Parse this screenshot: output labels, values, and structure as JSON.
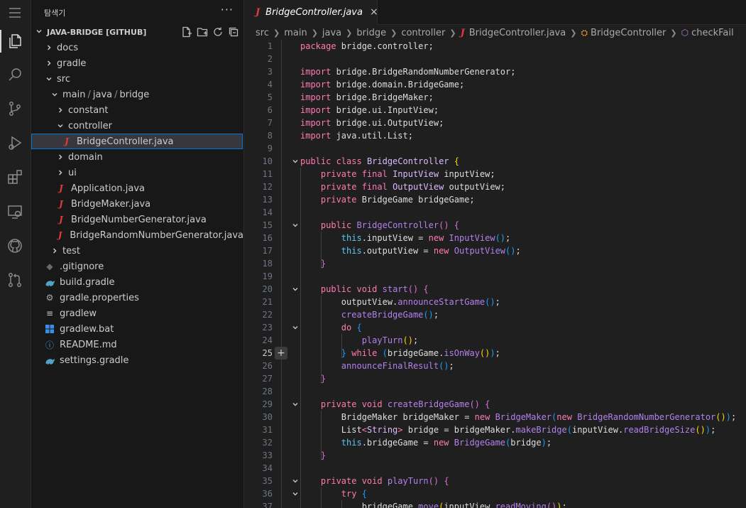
{
  "activity_bar": {
    "icons": [
      "menu-icon",
      "files-icon",
      "search-icon",
      "source-control-icon",
      "run-debug-icon",
      "extensions-icon",
      "remote-explorer-icon",
      "github-icon",
      "pull-requests-icon"
    ]
  },
  "sidebar": {
    "title": "탐색기",
    "more": "···",
    "section": "JAVA-BRIDGE [GITHUB]",
    "items": [
      {
        "label": "docs",
        "indent": 1,
        "kind": "folder",
        "open": false
      },
      {
        "label": "gradle",
        "indent": 1,
        "kind": "folder",
        "open": false
      },
      {
        "label": "src",
        "indent": 1,
        "kind": "folder",
        "open": true
      },
      {
        "label": "main/java/bridge",
        "indent": 2,
        "kind": "folder",
        "open": true,
        "compact": [
          "main",
          "java",
          "bridge"
        ]
      },
      {
        "label": "constant",
        "indent": 3,
        "kind": "folder",
        "open": false
      },
      {
        "label": "controller",
        "indent": 3,
        "kind": "folder",
        "open": true
      },
      {
        "label": "BridgeController.java",
        "indent": 4,
        "kind": "java",
        "selected": true
      },
      {
        "label": "domain",
        "indent": 3,
        "kind": "folder",
        "open": false
      },
      {
        "label": "ui",
        "indent": 3,
        "kind": "folder",
        "open": false
      },
      {
        "label": "Application.java",
        "indent": 3,
        "kind": "java"
      },
      {
        "label": "BridgeMaker.java",
        "indent": 3,
        "kind": "java"
      },
      {
        "label": "BridgeNumberGenerator.java",
        "indent": 3,
        "kind": "java"
      },
      {
        "label": "BridgeRandomNumberGenerator.java",
        "indent": 3,
        "kind": "java"
      },
      {
        "label": "test",
        "indent": 2,
        "kind": "folder",
        "open": false
      },
      {
        "label": ".gitignore",
        "indent": 1,
        "kind": "git"
      },
      {
        "label": "build.gradle",
        "indent": 1,
        "kind": "gradle"
      },
      {
        "label": "gradle.properties",
        "indent": 1,
        "kind": "gear"
      },
      {
        "label": "gradlew",
        "indent": 1,
        "kind": "lines"
      },
      {
        "label": "gradlew.bat",
        "indent": 1,
        "kind": "windows"
      },
      {
        "label": "README.md",
        "indent": 1,
        "kind": "info"
      },
      {
        "label": "settings.gradle",
        "indent": 1,
        "kind": "gradle"
      }
    ]
  },
  "tab": {
    "label": "BridgeController.java",
    "close": "×"
  },
  "breadcrumb": [
    "src",
    "main",
    "java",
    "bridge",
    "controller",
    "BridgeController.java",
    "BridgeController",
    "checkFail"
  ],
  "editor": {
    "cursor_line": 25,
    "fold_lines": [
      10,
      15,
      20,
      23,
      29,
      35,
      36
    ],
    "lines": [
      [
        [
          "kw",
          "package"
        ],
        [
          "pl",
          " bridge.controller;"
        ]
      ],
      [],
      [
        [
          "kw",
          "import"
        ],
        [
          "pl",
          " bridge.BridgeRandomNumberGenerator;"
        ]
      ],
      [
        [
          "kw",
          "import"
        ],
        [
          "pl",
          " bridge.domain.BridgeGame;"
        ]
      ],
      [
        [
          "kw",
          "import"
        ],
        [
          "pl",
          " bridge.BridgeMaker;"
        ]
      ],
      [
        [
          "kw",
          "import"
        ],
        [
          "pl",
          " bridge.ui.InputView;"
        ]
      ],
      [
        [
          "kw",
          "import"
        ],
        [
          "pl",
          " bridge.ui.OutputView;"
        ]
      ],
      [
        [
          "kw",
          "import"
        ],
        [
          "pl",
          " java.util.List;"
        ]
      ],
      [],
      [
        [
          "kw",
          "public class"
        ],
        [
          "pl",
          " "
        ],
        [
          "ty",
          "BridgeController"
        ],
        [
          "pl",
          " "
        ],
        [
          "pa1",
          "{"
        ]
      ],
      [
        [
          "pl",
          "    "
        ],
        [
          "kw",
          "private final"
        ],
        [
          "pl",
          " "
        ],
        [
          "ty",
          "InputView"
        ],
        [
          "pl",
          " inputView;"
        ]
      ],
      [
        [
          "pl",
          "    "
        ],
        [
          "kw",
          "private final"
        ],
        [
          "pl",
          " "
        ],
        [
          "ty",
          "OutputView"
        ],
        [
          "pl",
          " outputView;"
        ]
      ],
      [
        [
          "pl",
          "    "
        ],
        [
          "kw",
          "private"
        ],
        [
          "pl",
          " BridgeGame bridgeGame;"
        ]
      ],
      [],
      [
        [
          "pl",
          "    "
        ],
        [
          "kw",
          "public"
        ],
        [
          "pl",
          " "
        ],
        [
          "fn",
          "BridgeController"
        ],
        [
          "pa2",
          "()"
        ],
        [
          "pl",
          " "
        ],
        [
          "pa2",
          "{"
        ]
      ],
      [
        [
          "pl",
          "        "
        ],
        [
          "th",
          "this"
        ],
        [
          "pl",
          ".inputView = "
        ],
        [
          "kw",
          "new"
        ],
        [
          "pl",
          " "
        ],
        [
          "fn",
          "InputView"
        ],
        [
          "pa3",
          "()"
        ],
        [
          "pl",
          ";"
        ]
      ],
      [
        [
          "pl",
          "        "
        ],
        [
          "th",
          "this"
        ],
        [
          "pl",
          ".outputView = "
        ],
        [
          "kw",
          "new"
        ],
        [
          "pl",
          " "
        ],
        [
          "fn",
          "OutputView"
        ],
        [
          "pa3",
          "()"
        ],
        [
          "pl",
          ";"
        ]
      ],
      [
        [
          "pl",
          "    "
        ],
        [
          "pa2",
          "}"
        ]
      ],
      [],
      [
        [
          "pl",
          "    "
        ],
        [
          "kw",
          "public void"
        ],
        [
          "pl",
          " "
        ],
        [
          "fn",
          "start"
        ],
        [
          "pa2",
          "()"
        ],
        [
          "pl",
          " "
        ],
        [
          "pa2",
          "{"
        ]
      ],
      [
        [
          "pl",
          "        outputView."
        ],
        [
          "fn",
          "announceStartGame"
        ],
        [
          "pa3",
          "()"
        ],
        [
          "pl",
          ";"
        ]
      ],
      [
        [
          "pl",
          "        "
        ],
        [
          "fn",
          "createBridgeGame"
        ],
        [
          "pa3",
          "()"
        ],
        [
          "pl",
          ";"
        ]
      ],
      [
        [
          "pl",
          "        "
        ],
        [
          "kw",
          "do"
        ],
        [
          "pl",
          " "
        ],
        [
          "pa3",
          "{"
        ]
      ],
      [
        [
          "pl",
          "            "
        ],
        [
          "fn",
          "playTurn"
        ],
        [
          "pa1",
          "()"
        ],
        [
          "pl",
          ";"
        ]
      ],
      [
        [
          "pl",
          "        "
        ],
        [
          "pa3",
          "}"
        ],
        [
          "pl",
          " "
        ],
        [
          "kw",
          "while"
        ],
        [
          "pl",
          " "
        ],
        [
          "pa3",
          "("
        ],
        [
          "pl",
          "bridgeGame."
        ],
        [
          "fn",
          "isOnWay"
        ],
        [
          "pa1",
          "()"
        ],
        [
          "pa3",
          ")"
        ],
        [
          "pl",
          ";"
        ]
      ],
      [
        [
          "pl",
          "        "
        ],
        [
          "fn",
          "announceFinalResult"
        ],
        [
          "pa3",
          "()"
        ],
        [
          "pl",
          ";"
        ]
      ],
      [
        [
          "pl",
          "    "
        ],
        [
          "pa2",
          "}"
        ]
      ],
      [],
      [
        [
          "pl",
          "    "
        ],
        [
          "kw",
          "private void"
        ],
        [
          "pl",
          " "
        ],
        [
          "fn",
          "createBridgeGame"
        ],
        [
          "pa2",
          "()"
        ],
        [
          "pl",
          " "
        ],
        [
          "pa2",
          "{"
        ]
      ],
      [
        [
          "pl",
          "        BridgeMaker bridgeMaker = "
        ],
        [
          "kw",
          "new"
        ],
        [
          "pl",
          " "
        ],
        [
          "fn",
          "BridgeMaker"
        ],
        [
          "pa3",
          "("
        ],
        [
          "kw",
          "new"
        ],
        [
          "pl",
          " "
        ],
        [
          "fn",
          "BridgeRandomNumberGenerator"
        ],
        [
          "pa1",
          "()"
        ],
        [
          "pa3",
          ")"
        ],
        [
          "pl",
          ";"
        ]
      ],
      [
        [
          "pl",
          "        List"
        ],
        [
          "kw",
          "<"
        ],
        [
          "ty",
          "String"
        ],
        [
          "kw",
          ">"
        ],
        [
          "pl",
          " bridge = bridgeMaker."
        ],
        [
          "fn",
          "makeBridge"
        ],
        [
          "pa3",
          "("
        ],
        [
          "pl",
          "inputView."
        ],
        [
          "fn",
          "readBridgeSize"
        ],
        [
          "pa1",
          "()"
        ],
        [
          "pa3",
          ")"
        ],
        [
          "pl",
          ";"
        ]
      ],
      [
        [
          "pl",
          "        "
        ],
        [
          "th",
          "this"
        ],
        [
          "pl",
          ".bridgeGame = "
        ],
        [
          "kw",
          "new"
        ],
        [
          "pl",
          " "
        ],
        [
          "fn",
          "BridgeGame"
        ],
        [
          "pa3",
          "("
        ],
        [
          "pl",
          "bridge"
        ],
        [
          "pa3",
          ")"
        ],
        [
          "pl",
          ";"
        ]
      ],
      [
        [
          "pl",
          "    "
        ],
        [
          "pa2",
          "}"
        ]
      ],
      [],
      [
        [
          "pl",
          "    "
        ],
        [
          "kw",
          "private void"
        ],
        [
          "pl",
          " "
        ],
        [
          "fn",
          "playTurn"
        ],
        [
          "pa2",
          "()"
        ],
        [
          "pl",
          " "
        ],
        [
          "pa2",
          "{"
        ]
      ],
      [
        [
          "pl",
          "        "
        ],
        [
          "kw",
          "try"
        ],
        [
          "pl",
          " "
        ],
        [
          "pa3",
          "{"
        ]
      ],
      [
        [
          "pl",
          "            bridgeGame."
        ],
        [
          "fn",
          "move"
        ],
        [
          "pa1",
          "("
        ],
        [
          "pl",
          "inputView."
        ],
        [
          "fn",
          "readMoving"
        ],
        [
          "pa2",
          "()"
        ],
        [
          "pa1",
          ")"
        ],
        [
          "pl",
          ";"
        ]
      ]
    ]
  }
}
